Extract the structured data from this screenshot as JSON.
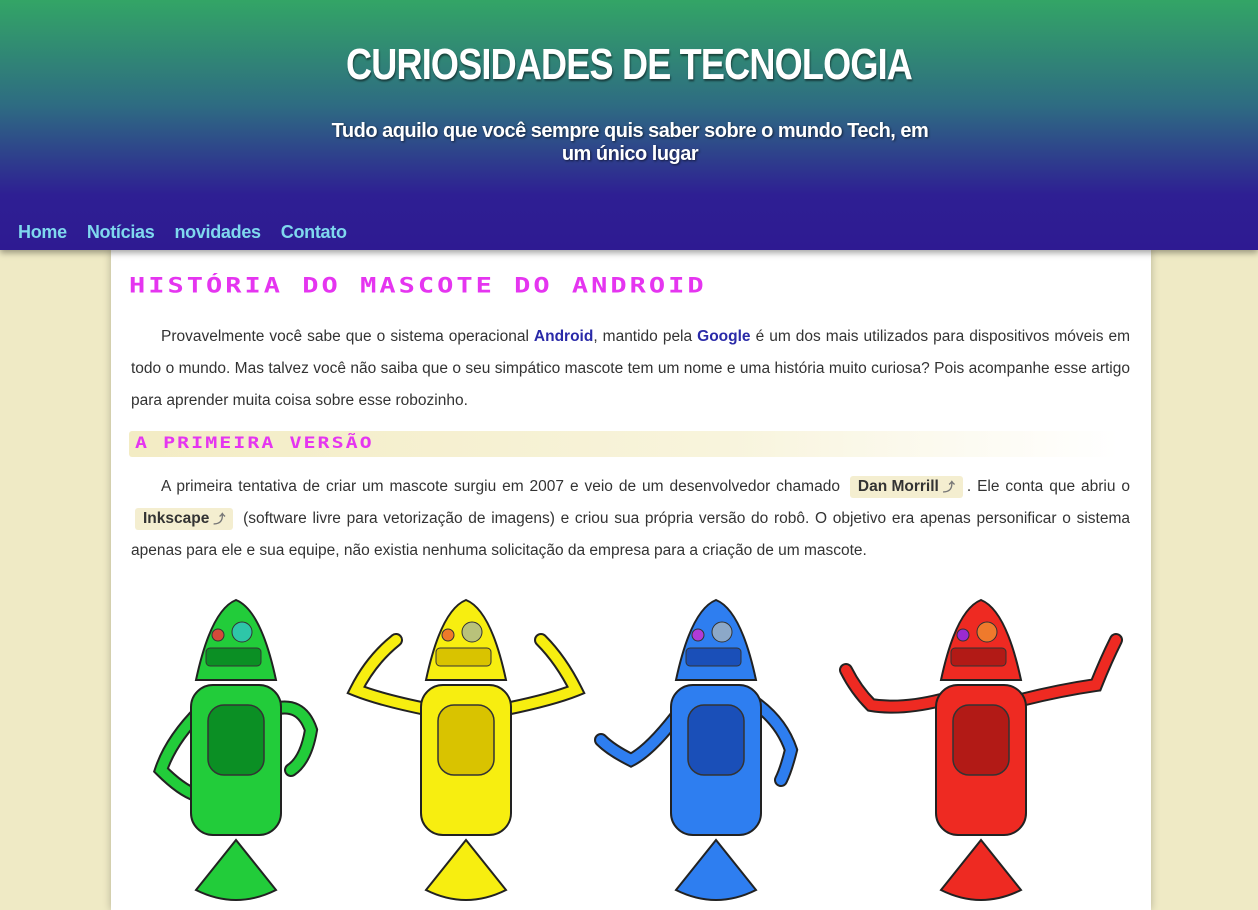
{
  "site": {
    "title": "CURIOSIDADES DE TECNOLOGIA",
    "subtitle": "Tudo aquilo que você sempre quis saber sobre o mundo Tech, em um único lugar"
  },
  "nav": {
    "items": [
      "Home",
      "Notícias",
      "novidades",
      "Contato"
    ]
  },
  "article": {
    "title": "História do mascote do Android",
    "intro": {
      "part1": "Provavelmente você sabe que o sistema operacional ",
      "link_android": "Android",
      "part2": ", mantido pela ",
      "link_google": "Google",
      "part3": " é um dos mais utilizados para dispositivos móveis em todo o mundo. Mas talvez você não saiba que o seu simpático mascote tem um nome e uma história muito curiosa? Pois acompanhe esse artigo para aprender muita coisa sobre esse robozinho."
    },
    "section1": {
      "heading": "A primeira versão",
      "part1": "A primeira tentativa de criar um mascote surgiu em 2007 e veio de um desenvolvedor chamado ",
      "link_dan": "Dan Morrill",
      "part2": ". Ele conta que abriu o ",
      "link_inkscape": "Inkscape",
      "part3": " (software livre para vetorização de imagens) e criou sua própria versão do robô. O objetivo era apenas personificar o sistema apenas para ele e sua equipe, não existia nenhuma solicitação da empresa para a criação de um mascote."
    }
  },
  "robots": [
    {
      "color": "#22cc3a",
      "dark": "#0b8f24",
      "eye1": "#d44a3a",
      "eye2": "#2ec6a8"
    },
    {
      "color": "#f7ee10",
      "dark": "#d9c300",
      "eye1": "#ee7a2a",
      "eye2": "#b9c27a"
    },
    {
      "color": "#2e7ef0",
      "dark": "#1a4fb8",
      "eye1": "#b03ad8",
      "eye2": "#8ca8c8"
    },
    {
      "color": "#ee2a22",
      "dark": "#b21a16",
      "eye1": "#9b2ad0",
      "eye2": "#ef7a2c"
    }
  ],
  "icons": {
    "external_link": "external-link-icon"
  }
}
